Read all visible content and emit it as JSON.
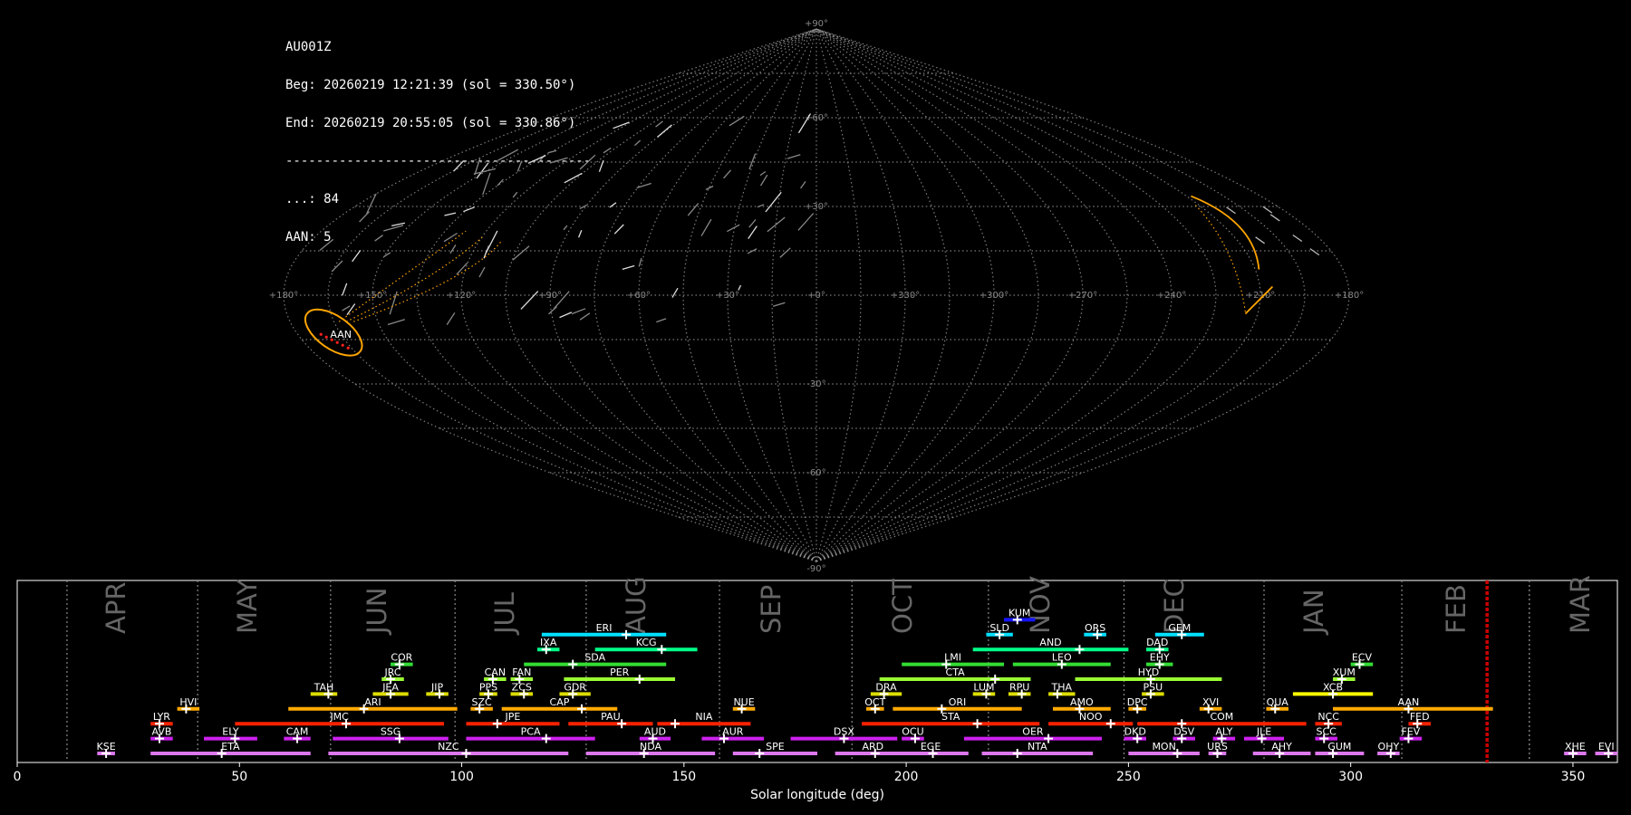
{
  "colors": {
    "background": "#000000",
    "grid": "#9a9a9a",
    "axis": "#ffffff",
    "month_text": "#666666",
    "current_marker": "#cc0000",
    "aan_highlight": "#ffa500"
  },
  "info_lines": [
    "AU001Z",
    "Beg: 20260219 12:21:39 (sol = 330.50°)",
    "End: 20260219 20:55:05 (sol = 330.86°)",
    "----------------------------------------",
    "...: 84",
    "AAN: 5"
  ],
  "sky_map": {
    "projection": "sinusoidal",
    "longitude_labels": [
      "+180°",
      "+150°",
      "+120°",
      "+90°",
      "+60°",
      "+30°",
      "+0°",
      "+330°",
      "+300°",
      "+270°",
      "+240°",
      "+210°",
      "+180°"
    ],
    "latitude_labels": [
      "+90°",
      "+60°",
      "+30°",
      "-30°",
      "-60°",
      "-90°"
    ],
    "radiant_label": "AAN"
  },
  "chart_data": {
    "type": "timeline",
    "xlabel": "Solar longitude (deg)",
    "xlim": [
      0,
      360
    ],
    "xticks": [
      "0",
      "50",
      "100",
      "150",
      "200",
      "250",
      "300",
      "350"
    ],
    "current_sol": [
      330.5,
      330.86
    ],
    "months": [
      {
        "name": "APR",
        "start": 11.2,
        "end": 40.6
      },
      {
        "name": "MAY",
        "start": 40.6,
        "end": 70.5
      },
      {
        "name": "JUN",
        "start": 70.5,
        "end": 98.5
      },
      {
        "name": "JUL",
        "start": 98.5,
        "end": 128.0
      },
      {
        "name": "AUG",
        "start": 128.0,
        "end": 158.0
      },
      {
        "name": "SEP",
        "start": 158.0,
        "end": 187.8
      },
      {
        "name": "OCT",
        "start": 187.8,
        "end": 248.5
      },
      {
        "name": "NOV",
        "start": 218.5,
        "end": 249.0
      },
      {
        "name": "DEC",
        "start": 249.0,
        "end": 280.5
      },
      {
        "name": "JAN",
        "start": 280.5,
        "end": 311.5
      },
      {
        "name": "FEB",
        "start": 311.5,
        "end": 340.2
      },
      {
        "name": "MAR",
        "start": 340.2,
        "end": 371.2
      }
    ],
    "showers": [
      {
        "code": "KUM",
        "start": 222,
        "end": 229,
        "peak": 225,
        "row": 9,
        "color": "#1515ff"
      },
      {
        "code": "ERI",
        "start": 118,
        "end": 146,
        "peak": 137,
        "row": 8,
        "color": "#00e0ff"
      },
      {
        "code": "SLD",
        "start": 218,
        "end": 224,
        "peak": 221,
        "row": 8,
        "color": "#00e0ff"
      },
      {
        "code": "ORS",
        "start": 240,
        "end": 245,
        "peak": 243,
        "row": 8,
        "color": "#00e0ff"
      },
      {
        "code": "GEM",
        "start": 256,
        "end": 267,
        "peak": 262,
        "row": 8,
        "color": "#00e0ff"
      },
      {
        "code": "IXA",
        "start": 117,
        "end": 122,
        "peak": 119,
        "row": 7,
        "color": "#00ff88"
      },
      {
        "code": "KCG",
        "start": 130,
        "end": 153,
        "peak": 145,
        "row": 7,
        "color": "#00ff88"
      },
      {
        "code": "AND",
        "start": 215,
        "end": 250,
        "peak": 239,
        "row": 7,
        "color": "#00ff88"
      },
      {
        "code": "DAD",
        "start": 254,
        "end": 259,
        "peak": 257,
        "row": 7,
        "color": "#00ff88"
      },
      {
        "code": "COR",
        "start": 84,
        "end": 89,
        "peak": 86,
        "row": 6,
        "color": "#33dd33"
      },
      {
        "code": "SDA",
        "start": 114,
        "end": 146,
        "peak": 125,
        "row": 6,
        "color": "#33dd33"
      },
      {
        "code": "LMI",
        "start": 199,
        "end": 222,
        "peak": 209,
        "row": 6,
        "color": "#33dd33"
      },
      {
        "code": "LEO",
        "start": 224,
        "end": 246,
        "peak": 235,
        "row": 6,
        "color": "#33dd33"
      },
      {
        "code": "EHY",
        "start": 254,
        "end": 260,
        "peak": 257,
        "row": 6,
        "color": "#33dd33"
      },
      {
        "code": "ECV",
        "start": 300,
        "end": 305,
        "peak": 302,
        "row": 6,
        "color": "#33dd33"
      },
      {
        "code": "JRC",
        "start": 82,
        "end": 87,
        "peak": 84,
        "row": 5,
        "color": "#99ff33"
      },
      {
        "code": "CAN",
        "start": 105,
        "end": 110,
        "peak": 107,
        "row": 5,
        "color": "#99ff33"
      },
      {
        "code": "FAN",
        "start": 111,
        "end": 116,
        "peak": 113,
        "row": 5,
        "color": "#99ff33"
      },
      {
        "code": "PER",
        "start": 123,
        "end": 148,
        "peak": 140,
        "row": 5,
        "color": "#99ff33"
      },
      {
        "code": "CTA",
        "start": 194,
        "end": 228,
        "peak": 220,
        "row": 5,
        "color": "#99ff33"
      },
      {
        "code": "HYD",
        "start": 238,
        "end": 271,
        "peak": 255,
        "row": 5,
        "color": "#99ff33"
      },
      {
        "code": "XUM",
        "start": 296,
        "end": 301,
        "peak": 298,
        "row": 5,
        "color": "#99ff33"
      },
      {
        "code": "TAH",
        "start": 66,
        "end": 72,
        "peak": 70,
        "row": 4,
        "color": "#dddd00"
      },
      {
        "code": "JEA",
        "start": 80,
        "end": 88,
        "peak": 84,
        "row": 4,
        "color": "#dddd00"
      },
      {
        "code": "JIP",
        "start": 92,
        "end": 97,
        "peak": 95,
        "row": 4,
        "color": "#dddd00"
      },
      {
        "code": "PPS",
        "start": 104,
        "end": 108,
        "peak": 106,
        "row": 4,
        "color": "#dddd00"
      },
      {
        "code": "ZCS",
        "start": 111,
        "end": 116,
        "peak": 114,
        "row": 4,
        "color": "#dddd00"
      },
      {
        "code": "GDR",
        "start": 122,
        "end": 129,
        "peak": 125,
        "row": 4,
        "color": "#dddd00"
      },
      {
        "code": "DRA",
        "start": 192,
        "end": 199,
        "peak": 195,
        "row": 4,
        "color": "#dddd00"
      },
      {
        "code": "LUM",
        "start": 215,
        "end": 220,
        "peak": 218,
        "row": 4,
        "color": "#dddd00"
      },
      {
        "code": "RPU",
        "start": 223,
        "end": 228,
        "peak": 226,
        "row": 4,
        "color": "#dddd00"
      },
      {
        "code": "THA",
        "start": 232,
        "end": 238,
        "peak": 234,
        "row": 4,
        "color": "#dddd00"
      },
      {
        "code": "PSU",
        "start": 253,
        "end": 258,
        "peak": 255,
        "row": 4,
        "color": "#dddd00"
      },
      {
        "code": "XCB",
        "start": 287,
        "end": 305,
        "peak": 296,
        "row": 4,
        "color": "#ffff00"
      },
      {
        "code": "HVI",
        "start": 36,
        "end": 41,
        "peak": 38,
        "row": 3,
        "color": "#ffaa00"
      },
      {
        "code": "ARI",
        "start": 61,
        "end": 99,
        "peak": 78,
        "row": 3,
        "color": "#ffaa00"
      },
      {
        "code": "SZC",
        "start": 102,
        "end": 107,
        "peak": 104,
        "row": 3,
        "color": "#ffaa00"
      },
      {
        "code": "CAP",
        "start": 109,
        "end": 135,
        "peak": 127,
        "row": 3,
        "color": "#ffaa00"
      },
      {
        "code": "NUE",
        "start": 161,
        "end": 166,
        "peak": 163,
        "row": 3,
        "color": "#ffaa00"
      },
      {
        "code": "OCT",
        "start": 191,
        "end": 195,
        "peak": 193,
        "row": 3,
        "color": "#ffaa00"
      },
      {
        "code": "ORI",
        "start": 197,
        "end": 226,
        "peak": 208,
        "row": 3,
        "color": "#ffaa00"
      },
      {
        "code": "AMO",
        "start": 233,
        "end": 246,
        "peak": 239,
        "row": 3,
        "color": "#ffaa00"
      },
      {
        "code": "DPC",
        "start": 250,
        "end": 254,
        "peak": 252,
        "row": 3,
        "color": "#ffaa00"
      },
      {
        "code": "XVI",
        "start": 266,
        "end": 271,
        "peak": 268,
        "row": 3,
        "color": "#ffaa00"
      },
      {
        "code": "QUA",
        "start": 281,
        "end": 286,
        "peak": 283,
        "row": 3,
        "color": "#ffaa00"
      },
      {
        "code": "AAN",
        "start": 296,
        "end": 332,
        "peak": 313,
        "row": 3,
        "color": "#ffaa00"
      },
      {
        "code": "LYR",
        "start": 30,
        "end": 35,
        "peak": 32,
        "row": 2,
        "color": "#ff2200"
      },
      {
        "code": "JMC",
        "start": 49,
        "end": 96,
        "peak": 74,
        "row": 2,
        "color": "#ff2200"
      },
      {
        "code": "JPE",
        "start": 101,
        "end": 122,
        "peak": 108,
        "row": 2,
        "color": "#ff2200"
      },
      {
        "code": "PAU",
        "start": 124,
        "end": 143,
        "peak": 136,
        "row": 2,
        "color": "#ff2200"
      },
      {
        "code": "NIA",
        "start": 144,
        "end": 165,
        "peak": 148,
        "row": 2,
        "color": "#ff2200"
      },
      {
        "code": "STA",
        "start": 190,
        "end": 230,
        "peak": 216,
        "row": 2,
        "color": "#ff2200"
      },
      {
        "code": "NOO",
        "start": 232,
        "end": 251,
        "peak": 246,
        "row": 2,
        "color": "#ff2200"
      },
      {
        "code": "COM",
        "start": 252,
        "end": 290,
        "peak": 262,
        "row": 2,
        "color": "#ff2200"
      },
      {
        "code": "NCC",
        "start": 292,
        "end": 298,
        "peak": 295,
        "row": 2,
        "color": "#ff2200"
      },
      {
        "code": "FED",
        "start": 313,
        "end": 318,
        "peak": 315,
        "row": 2,
        "color": "#ff2200"
      },
      {
        "code": "AVB",
        "start": 30,
        "end": 35,
        "peak": 32,
        "row": 1,
        "color": "#cc22ee"
      },
      {
        "code": "ELY",
        "start": 42,
        "end": 54,
        "peak": 49,
        "row": 1,
        "color": "#cc22ee"
      },
      {
        "code": "CAM",
        "start": 60,
        "end": 66,
        "peak": 63,
        "row": 1,
        "color": "#cc22ee"
      },
      {
        "code": "SSG",
        "start": 71,
        "end": 97,
        "peak": 86,
        "row": 1,
        "color": "#cc22ee"
      },
      {
        "code": "PCA",
        "start": 101,
        "end": 130,
        "peak": 119,
        "row": 1,
        "color": "#cc22ee"
      },
      {
        "code": "AUD",
        "start": 140,
        "end": 147,
        "peak": 143,
        "row": 1,
        "color": "#cc22ee"
      },
      {
        "code": "AUR",
        "start": 154,
        "end": 168,
        "peak": 159,
        "row": 1,
        "color": "#cc22ee"
      },
      {
        "code": "DSX",
        "start": 174,
        "end": 198,
        "peak": 186,
        "row": 1,
        "color": "#cc22ee"
      },
      {
        "code": "OCU",
        "start": 199,
        "end": 204,
        "peak": 202,
        "row": 1,
        "color": "#cc22ee"
      },
      {
        "code": "OER",
        "start": 213,
        "end": 244,
        "peak": 232,
        "row": 1,
        "color": "#cc22ee"
      },
      {
        "code": "DKD",
        "start": 249,
        "end": 254,
        "peak": 252,
        "row": 1,
        "color": "#cc22ee"
      },
      {
        "code": "DSV",
        "start": 260,
        "end": 265,
        "peak": 262,
        "row": 1,
        "color": "#cc22ee"
      },
      {
        "code": "ALY",
        "start": 269,
        "end": 274,
        "peak": 271,
        "row": 1,
        "color": "#cc22ee"
      },
      {
        "code": "JLE",
        "start": 276,
        "end": 285,
        "peak": 280,
        "row": 1,
        "color": "#cc22ee"
      },
      {
        "code": "SCC",
        "start": 292,
        "end": 297,
        "peak": 294,
        "row": 1,
        "color": "#cc22ee"
      },
      {
        "code": "FEV",
        "start": 311,
        "end": 316,
        "peak": 313,
        "row": 1,
        "color": "#cc22ee"
      },
      {
        "code": "KSE",
        "start": 18,
        "end": 22,
        "peak": 20,
        "row": 0,
        "color": "#dd77ee"
      },
      {
        "code": "ETA",
        "start": 30,
        "end": 66,
        "peak": 46,
        "row": 0,
        "color": "#dd77ee"
      },
      {
        "code": "NZC",
        "start": 70,
        "end": 124,
        "peak": 101,
        "row": 0,
        "color": "#dd77ee"
      },
      {
        "code": "NDA",
        "start": 128,
        "end": 157,
        "peak": 141,
        "row": 0,
        "color": "#dd77ee"
      },
      {
        "code": "SPE",
        "start": 161,
        "end": 180,
        "peak": 167,
        "row": 0,
        "color": "#dd77ee"
      },
      {
        "code": "ARD",
        "start": 184,
        "end": 201,
        "peak": 193,
        "row": 0,
        "color": "#dd77ee"
      },
      {
        "code": "EGE",
        "start": 197,
        "end": 214,
        "peak": 206,
        "row": 0,
        "color": "#dd77ee"
      },
      {
        "code": "NTA",
        "start": 217,
        "end": 242,
        "peak": 225,
        "row": 0,
        "color": "#dd77ee"
      },
      {
        "code": "MON",
        "start": 250,
        "end": 266,
        "peak": 261,
        "row": 0,
        "color": "#dd77ee"
      },
      {
        "code": "URS",
        "start": 268,
        "end": 272,
        "peak": 270,
        "row": 0,
        "color": "#dd77ee"
      },
      {
        "code": "AHY",
        "start": 278,
        "end": 291,
        "peak": 284,
        "row": 0,
        "color": "#dd77ee"
      },
      {
        "code": "GUM",
        "start": 292,
        "end": 303,
        "peak": 296,
        "row": 0,
        "color": "#dd77ee"
      },
      {
        "code": "OHY",
        "start": 306,
        "end": 311,
        "peak": 309,
        "row": 0,
        "color": "#dd77ee"
      },
      {
        "code": "XHE",
        "start": 348,
        "end": 353,
        "peak": 350,
        "row": 0,
        "color": "#dd77ee"
      },
      {
        "code": "EVI",
        "start": 355,
        "end": 360,
        "peak": 358,
        "row": 0,
        "color": "#dd77ee"
      }
    ]
  }
}
